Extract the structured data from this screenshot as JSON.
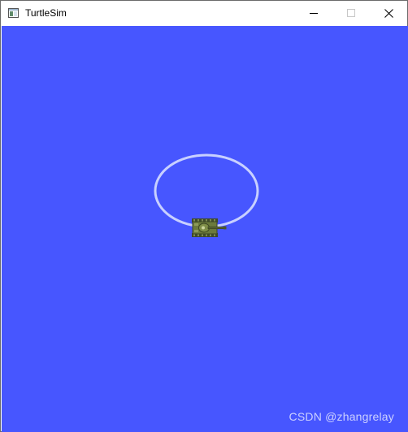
{
  "window": {
    "title": "TurtleSim",
    "icon": "turtlesim-app-icon",
    "controls": {
      "minimize_icon": "minimize-icon",
      "maximize_icon": "maximize-icon",
      "close_icon": "close-icon"
    }
  },
  "canvas": {
    "background_color": "#4756FF",
    "trail_color": "#C8D0FF",
    "turtle_icon": "tank-turtle-icon",
    "turtle_heading": "east"
  },
  "watermark": "CSDN @zhangrelay"
}
